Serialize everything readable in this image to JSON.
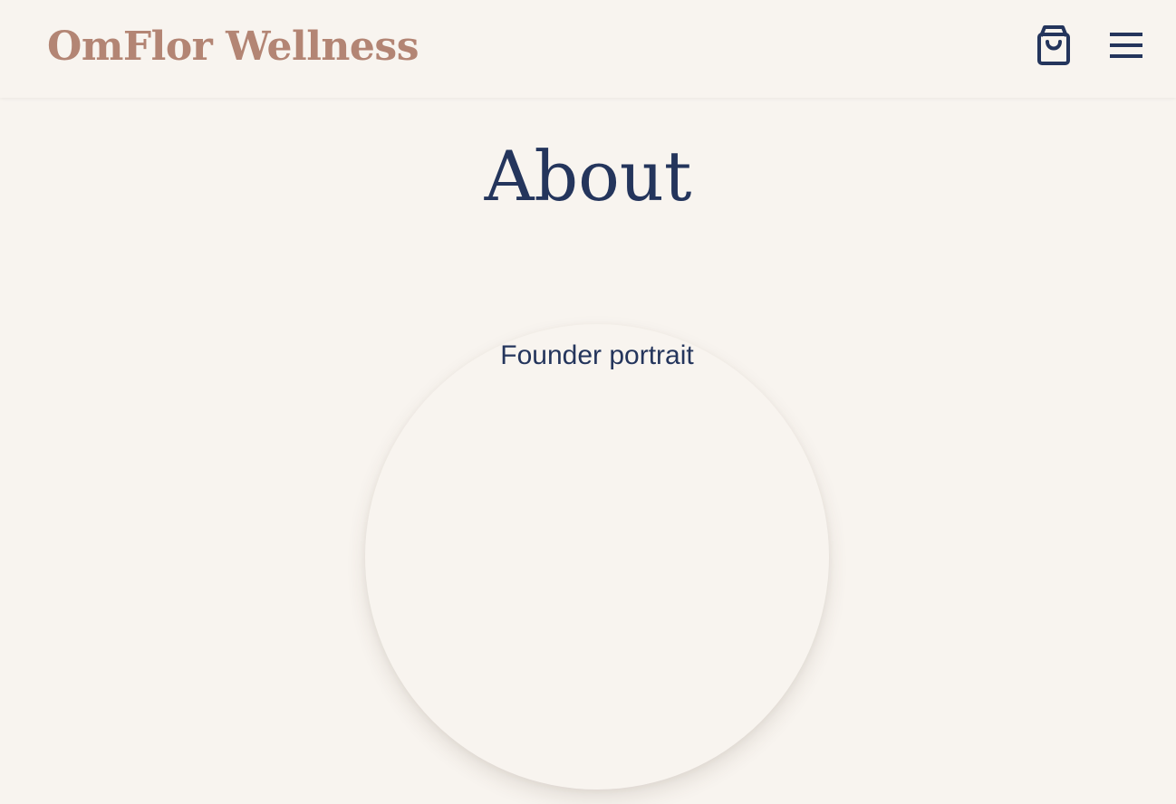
{
  "header": {
    "brand": "OmFlor Wellness",
    "cart_icon": "shopping-bag-icon",
    "menu_icon": "hamburger-menu-icon"
  },
  "main": {
    "title": "About",
    "portrait_alt": "Founder portrait"
  },
  "colors": {
    "background": "#f8f4ef",
    "brand": "#b38574",
    "primary_text": "#24355c"
  }
}
